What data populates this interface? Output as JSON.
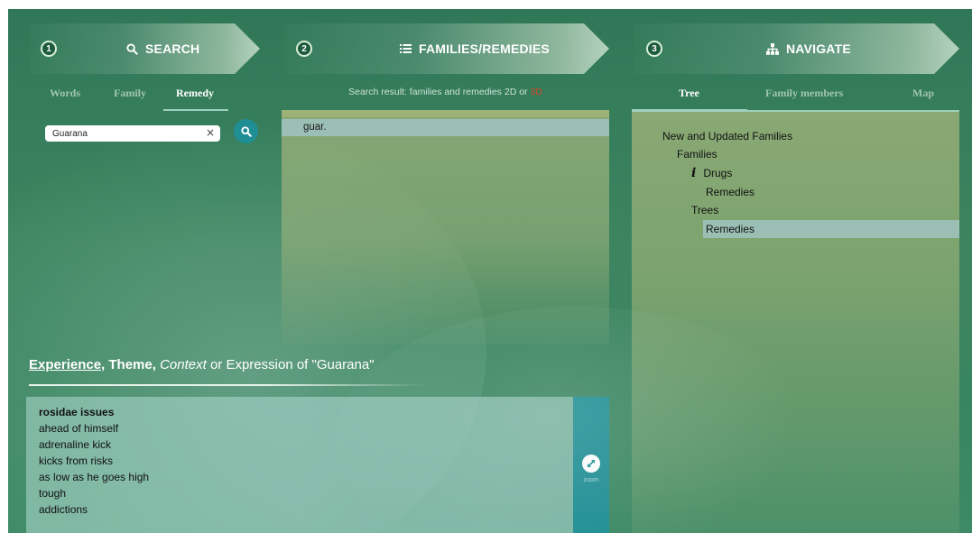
{
  "steps": [
    {
      "number": "1",
      "title": "SEARCH",
      "icon": "search-icon"
    },
    {
      "number": "2",
      "title": "FAMILIES/REMEDIES",
      "icon": "list-icon"
    },
    {
      "number": "3",
      "title": "NAVIGATE",
      "icon": "sitemap-icon"
    }
  ],
  "search": {
    "tabs": [
      "Words",
      "Family",
      "Remedy"
    ],
    "active_tab": "Remedy",
    "input_value": "Guarana",
    "clear_symbol": "×"
  },
  "results": {
    "caption_prefix": "Search result: families and remedies 2D or ",
    "caption_link": "3D",
    "items": [
      "guar."
    ]
  },
  "navigate": {
    "tabs": [
      "Tree",
      "Family members",
      "Map"
    ],
    "active_tab": "Tree",
    "tree": [
      "New and Updated Families",
      "Families",
      "Drugs",
      "Remedies",
      "Trees",
      "Remedies"
    ],
    "info_symbol": "i",
    "selected_item": "Remedies"
  },
  "experience": {
    "heading_experience": "Experience,",
    "heading_theme": "Theme,",
    "heading_context": "Context",
    "heading_rest": " or Expression of \"Guarana\"",
    "lines": [
      "rosidae issues",
      "ahead of himself",
      "adrenaline kick",
      "kicks from risks",
      "as low as he goes high",
      "tough",
      "addictions"
    ],
    "zoom_label": "zoom"
  },
  "colors": {
    "accent_teal": "#1f8e95",
    "link_red": "#d9462a",
    "selection": "#9cbfb5"
  }
}
